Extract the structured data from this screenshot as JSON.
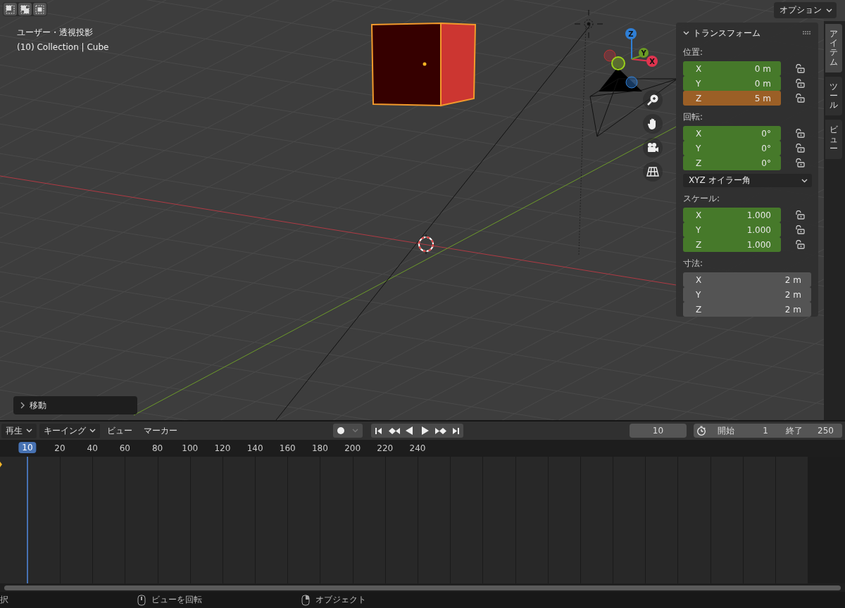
{
  "viewport": {
    "view_name": "ユーザー・透視投影",
    "object_info": "(10) Collection | Cube",
    "options_button": "オプション",
    "last_operator": "移動"
  },
  "gizmo": {
    "axes": [
      "Z",
      "Y",
      "X"
    ]
  },
  "side_tabs": [
    {
      "label": "アイテム",
      "selected": true
    },
    {
      "label": "ツール",
      "selected": false
    },
    {
      "label": "ビュー",
      "selected": false
    }
  ],
  "transform_panel": {
    "title": "トランスフォーム",
    "sections": [
      {
        "label": "位置:",
        "lockable": true,
        "fields": [
          {
            "axis": "X",
            "value": "0 m",
            "kind": "keyed"
          },
          {
            "axis": "Y",
            "value": "0 m",
            "kind": "keyed"
          },
          {
            "axis": "Z",
            "value": "5 m",
            "kind": "changed"
          }
        ]
      },
      {
        "label": "回転:",
        "lockable": true,
        "fields": [
          {
            "axis": "X",
            "value": "0°",
            "kind": "keyed"
          },
          {
            "axis": "Y",
            "value": "0°",
            "kind": "keyed"
          },
          {
            "axis": "Z",
            "value": "0°",
            "kind": "keyed"
          }
        ],
        "mode": "XYZ オイラー角"
      },
      {
        "label": "スケール:",
        "lockable": true,
        "fields": [
          {
            "axis": "X",
            "value": "1.000",
            "kind": "keyed"
          },
          {
            "axis": "Y",
            "value": "1.000",
            "kind": "keyed"
          },
          {
            "axis": "Z",
            "value": "1.000",
            "kind": "keyed"
          }
        ]
      },
      {
        "label": "寸法:",
        "lockable": false,
        "fields": [
          {
            "axis": "X",
            "value": "2 m",
            "kind": "plain"
          },
          {
            "axis": "Y",
            "value": "2 m",
            "kind": "plain"
          },
          {
            "axis": "Z",
            "value": "2 m",
            "kind": "plain"
          }
        ]
      }
    ]
  },
  "timeline": {
    "menus": [
      {
        "label": "再生",
        "dropdown": true
      },
      {
        "label": "キーイング",
        "dropdown": true
      },
      {
        "label": "ビュー",
        "dropdown": false
      },
      {
        "label": "マーカー",
        "dropdown": false
      }
    ],
    "current_frame": "10",
    "start_label": "開始",
    "start": "1",
    "end_label": "終了",
    "end": "250",
    "playhead": "10",
    "ticks": [
      "20",
      "40",
      "60",
      "80",
      "100",
      "120",
      "140",
      "160",
      "180",
      "200",
      "220",
      "240"
    ]
  },
  "status_bar": [
    {
      "text": "択",
      "kind": "plain"
    },
    {
      "text": "ビューを回転",
      "kind": "middle"
    },
    {
      "text": "オブジェクト",
      "kind": "right"
    }
  ]
}
